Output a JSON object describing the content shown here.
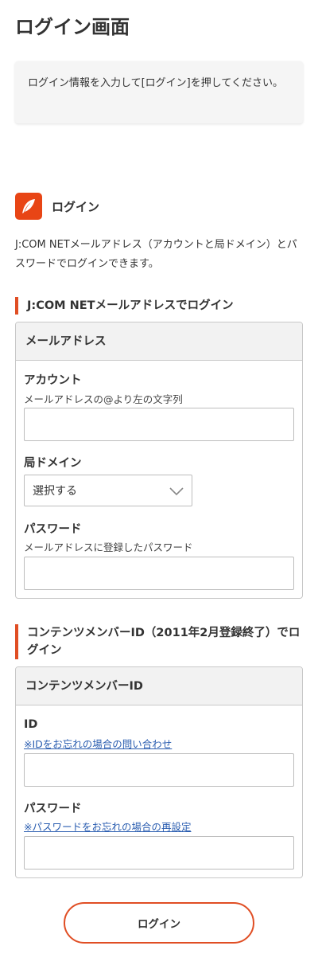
{
  "page": {
    "title": "ログイン画面",
    "notice": "ログイン情報を入力して[ログイン]を押してください。"
  },
  "brand": {
    "label": "ログイン",
    "logo_icon": "feather-icon",
    "logo_color": "#e84515"
  },
  "intro": "J:COM NETメールアドレス（アカウントと局ドメイン）とパスワードでログインできます。",
  "section_email": {
    "heading": "J:COM NETメールアドレスでログイン",
    "card_title": "メールアドレス",
    "account_label": "アカウント",
    "account_hint": "メールアドレスの@より左の文字列",
    "account_value": "",
    "domain_label": "局ドメイン",
    "domain_selected": "選択する",
    "password_label": "パスワード",
    "password_hint": "メールアドレスに登録したパスワード",
    "password_value": ""
  },
  "section_contents": {
    "heading": "コンテンツメンバーID（2011年2月登録終了）でログイン",
    "card_title": "コンテンツメンバーID",
    "id_label": "ID",
    "id_link": "※IDをお忘れの場合の問い合わせ",
    "id_value": "",
    "password_label": "パスワード",
    "password_link": "※パスワードをお忘れの場合の再設定",
    "password_value": ""
  },
  "login_button": "ログイン",
  "colors": {
    "accent": "#e04e24",
    "link": "#2a5db0"
  }
}
